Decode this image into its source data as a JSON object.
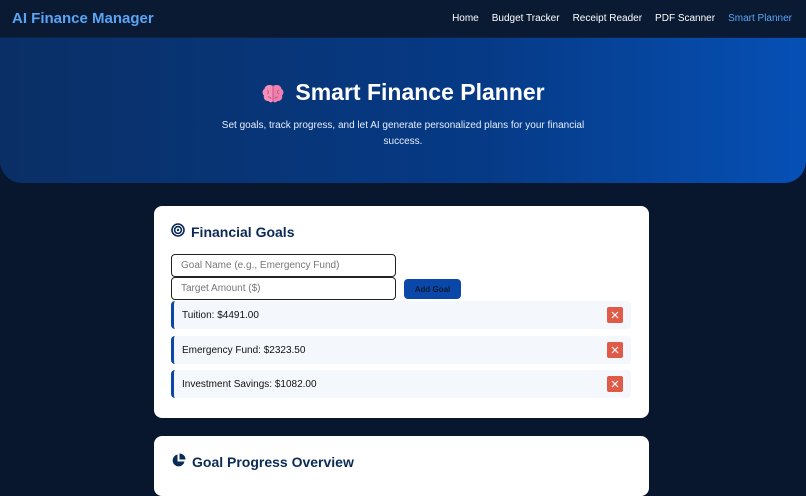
{
  "nav": {
    "brand": "AI Finance Manager",
    "links": [
      "Home",
      "Budget Tracker",
      "Receipt Reader",
      "PDF Scanner",
      "Smart Planner"
    ],
    "active": "Smart Planner"
  },
  "hero": {
    "icon": "brain-icon",
    "title": "Smart Finance Planner",
    "subtitle": "Set goals, track progress, and let AI generate personalized plans for your financial success."
  },
  "goals": {
    "icon": "target-icon",
    "title": "Financial Goals",
    "name_placeholder": "Goal Name (e.g., Emergency Fund)",
    "amount_placeholder": "Target Amount ($)",
    "add_label": "Add Goal",
    "items": [
      {
        "text": "Tuition: $4491.00"
      },
      {
        "text": "Emergency Fund: $2323.50"
      },
      {
        "text": "Investment Savings: $1082.00"
      }
    ],
    "delete_icon": "close-icon"
  },
  "progress": {
    "icon": "pie-chart-icon",
    "title": "Goal Progress Overview"
  },
  "colors": {
    "accent": "#5aa4f5",
    "primary": "#0a47a8",
    "danger": "#e05a48",
    "background": "#08162e"
  }
}
